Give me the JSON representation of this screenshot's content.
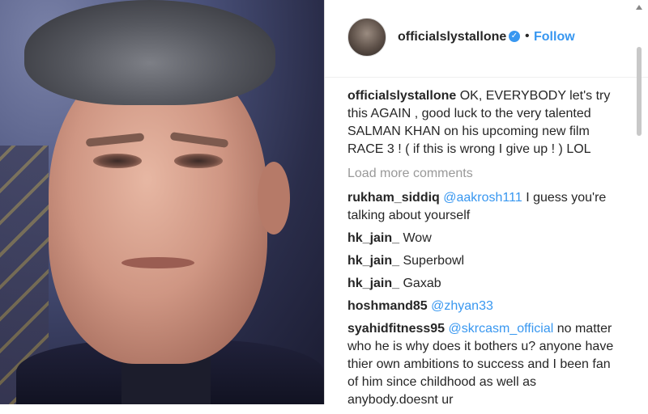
{
  "post": {
    "username": "officialslystallone",
    "separator": "•",
    "follow_label": "Follow",
    "verified_icon": "verified-badge-icon",
    "verified_glyph": "✓"
  },
  "caption": {
    "username": "officialslystallone",
    "text": " OK, EVERYBODY let's try this AGAIN , good luck to the very talented SALMAN KHAN on his upcoming new film RACE 3 ! ( if this is wrong I give up ! ) LOL"
  },
  "load_more_label": "Load more comments",
  "comments": [
    {
      "username": "rukham_siddiq",
      "mention": "@aakrosh111",
      "text": " I guess you're talking about yourself"
    },
    {
      "username": "hk_jain_",
      "text": " Wow"
    },
    {
      "username": "hk_jain_",
      "text": " Superbowl"
    },
    {
      "username": "hk_jain_",
      "text": " Gaxab"
    },
    {
      "username": "hoshmand85",
      "mention": "@zhyan33",
      "text": ""
    },
    {
      "username": "syahidfitness95",
      "mention": "@skrcasm_official",
      "text": " no matter who he is why does it bothers u? anyone have thier own ambitions to success and I been fan of him since childhood as well as anybody.doesnt ur"
    }
  ],
  "colors": {
    "link": "#3897f0",
    "text": "#262626",
    "muted": "#999999"
  }
}
